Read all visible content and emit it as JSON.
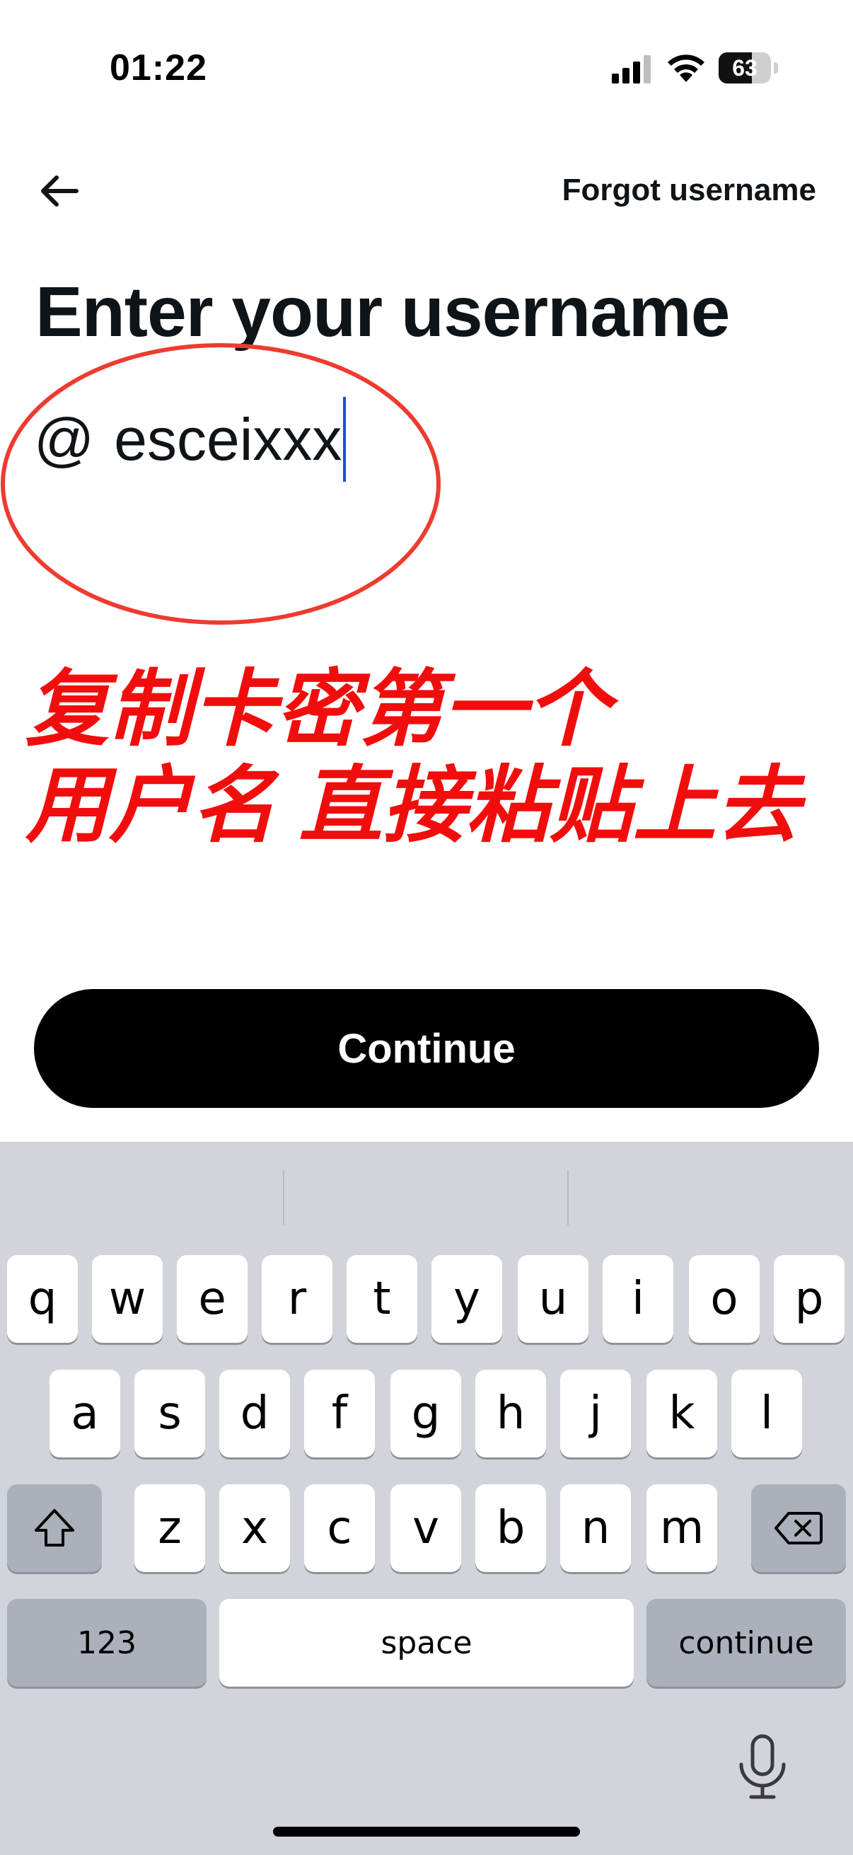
{
  "status_bar": {
    "time": "01:22",
    "battery": "63",
    "battery_level": 0.63
  },
  "nav": {
    "back_icon": "arrow-left-icon",
    "forgot_label": "Forgot username"
  },
  "title": "Enter your username",
  "username_field": {
    "prefix": "@",
    "value": "esceixxx"
  },
  "annotation": {
    "line1": "复制卡密第一个",
    "line2": "用户名 直接粘贴上去",
    "color": "#f20d0d"
  },
  "continue_label": "Continue",
  "keyboard": {
    "row1": [
      "q",
      "w",
      "e",
      "r",
      "t",
      "y",
      "u",
      "i",
      "o",
      "p"
    ],
    "row2": [
      "a",
      "s",
      "d",
      "f",
      "g",
      "h",
      "j",
      "k",
      "l"
    ],
    "row3": [
      "z",
      "x",
      "c",
      "v",
      "b",
      "n",
      "m"
    ],
    "shift_icon": "shift-icon",
    "delete_icon": "backspace-icon",
    "numbers_label": "123",
    "space_label": "space",
    "return_label": "continue",
    "mic_icon": "microphone-icon"
  }
}
